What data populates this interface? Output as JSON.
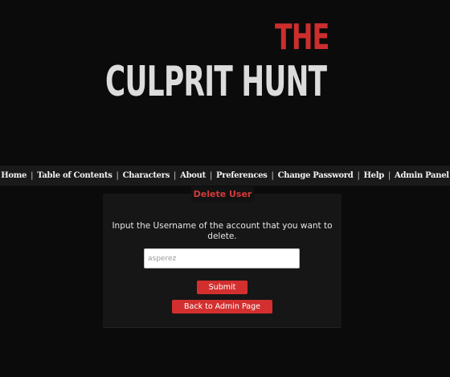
{
  "logo": {
    "the": "THE",
    "main": "CULPRIT HUNT"
  },
  "nav": {
    "items": [
      "Home",
      "Table of Contents",
      "Characters",
      "About",
      "Preferences",
      "Change Password",
      "Help",
      "Admin Panel"
    ],
    "separator": "|"
  },
  "panel": {
    "title": "Delete User",
    "instructions": "Input the Username of the account that you want to delete.",
    "username_value": "asperez",
    "submit_label": "Submit",
    "back_label": "Back to Admin Page"
  },
  "colors": {
    "accent": "#d32f2f",
    "background": "#0b0b0b",
    "nav_background": "#1a1a1a",
    "panel_background": "#161616"
  }
}
